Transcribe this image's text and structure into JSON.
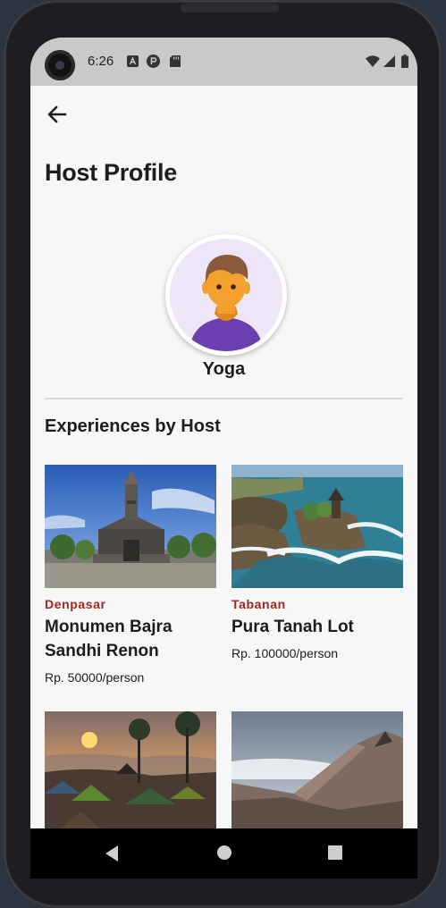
{
  "status_bar": {
    "time": "6:26",
    "left_icons": [
      "font-a-icon",
      "app-p-icon",
      "sd-card-icon"
    ],
    "right_icons": [
      "wifi-icon",
      "signal-icon",
      "battery-icon"
    ]
  },
  "header": {
    "back_icon": "arrow-left-icon",
    "title": "Host Profile"
  },
  "host": {
    "name": "Yoga",
    "avatar_icon": "person-avatar-icon"
  },
  "experiences": {
    "section_title": "Experiences by Host",
    "items": [
      {
        "location": "Denpasar",
        "title": "Monumen Bajra Sandhi Renon",
        "price": "Rp. 50000/person",
        "image": "monument-photo"
      },
      {
        "location": "Tabanan",
        "title": "Pura Tanah Lot",
        "price": "Rp. 100000/person",
        "image": "sea-temple-photo"
      },
      {
        "location": "",
        "title": "",
        "price": "",
        "image": "campsite-sunset-photo"
      },
      {
        "location": "",
        "title": "",
        "price": "",
        "image": "mountain-ridge-photo"
      }
    ]
  },
  "nav_bar": {
    "back_icon": "triangle-back-icon",
    "home_icon": "circle-home-icon",
    "recents_icon": "square-recents-icon"
  },
  "colors": {
    "location_accent": "#a8221f",
    "avatar_bg": "#ece6f6",
    "shirt": "#6a3fb0",
    "skin": "#f4a02c",
    "hair": "#8a5a3a"
  }
}
